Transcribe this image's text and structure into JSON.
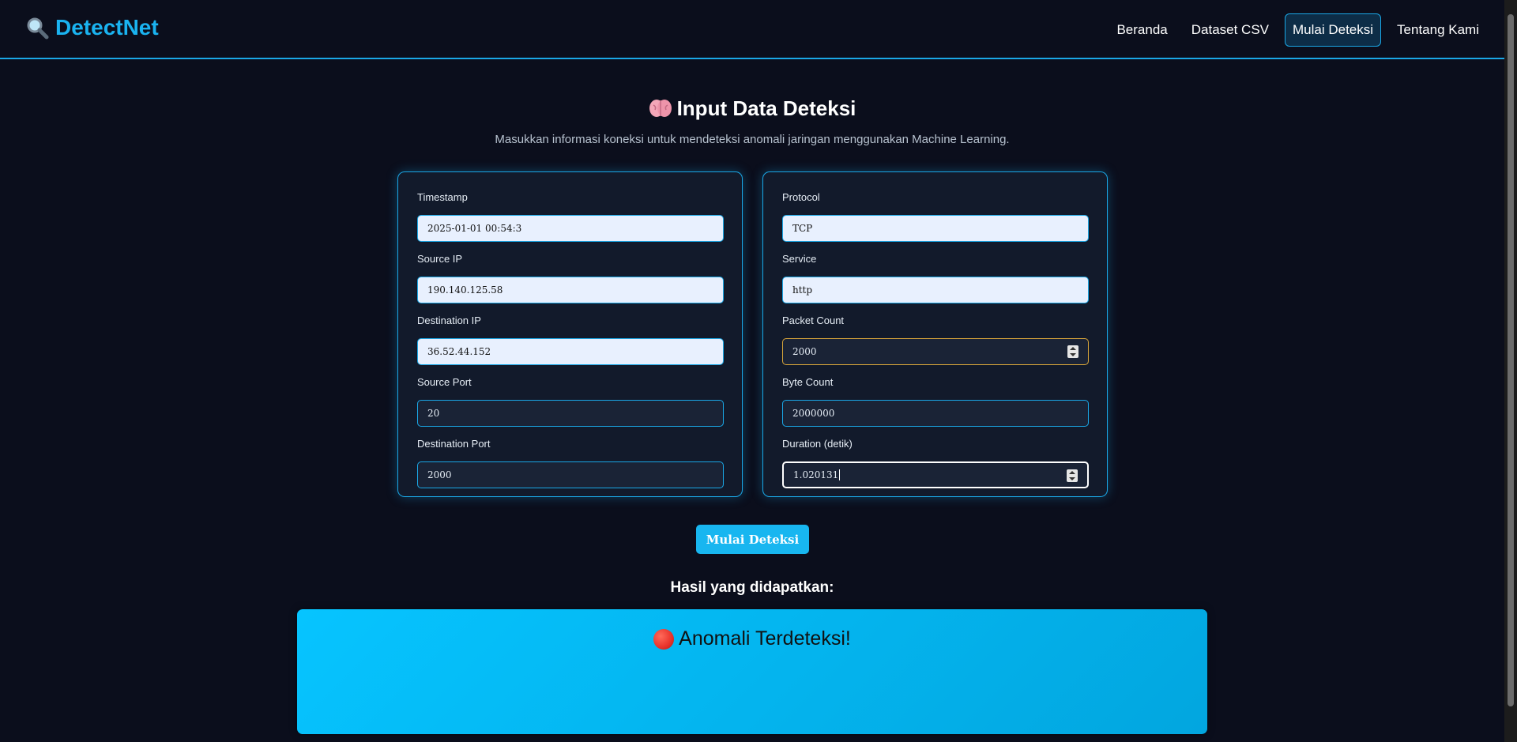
{
  "nav": {
    "logo_text": "DetectNet",
    "logo_icon": "magnifier-icon",
    "links": [
      "Beranda",
      "Dataset CSV",
      "Mulai Deteksi",
      "Tentang Kami"
    ],
    "active_link": "Mulai Deteksi"
  },
  "header": {
    "title": "Input Data Deteksi",
    "title_icon": "brain-icon",
    "subtitle": "Masukkan informasi koneksi untuk mendeteksi anomali jaringan menggunakan Machine Learning."
  },
  "form": {
    "left": {
      "timestamp": {
        "label": "Timestamp",
        "value": "2025-01-01 00:54:3"
      },
      "source_ip": {
        "label": "Source IP",
        "value": "190.140.125.58"
      },
      "destination_ip": {
        "label": "Destination IP",
        "value": "36.52.44.152"
      },
      "source_port": {
        "label": "Source Port",
        "value": "20"
      },
      "destination_port": {
        "label": "Destination Port",
        "value": "2000"
      }
    },
    "right": {
      "protocol": {
        "label": "Protocol",
        "value": "TCP"
      },
      "service": {
        "label": "Service",
        "value": "http"
      },
      "packet_count": {
        "label": "Packet Count",
        "value": "2000"
      },
      "byte_count": {
        "label": "Byte Count",
        "value": "2000000"
      },
      "duration": {
        "label": "Duration (detik)",
        "value": "1.020131"
      }
    },
    "submit_label": "Mulai Deteksi"
  },
  "result": {
    "heading": "Hasil yang didapatkan:",
    "text": "Anomali Terdeteksi!",
    "status_icon": "red-circle-icon",
    "accent_color": "#06c4ff"
  },
  "colors": {
    "background": "#0b0e1c",
    "accent": "#1aa7e6",
    "card": "#121a2b"
  }
}
